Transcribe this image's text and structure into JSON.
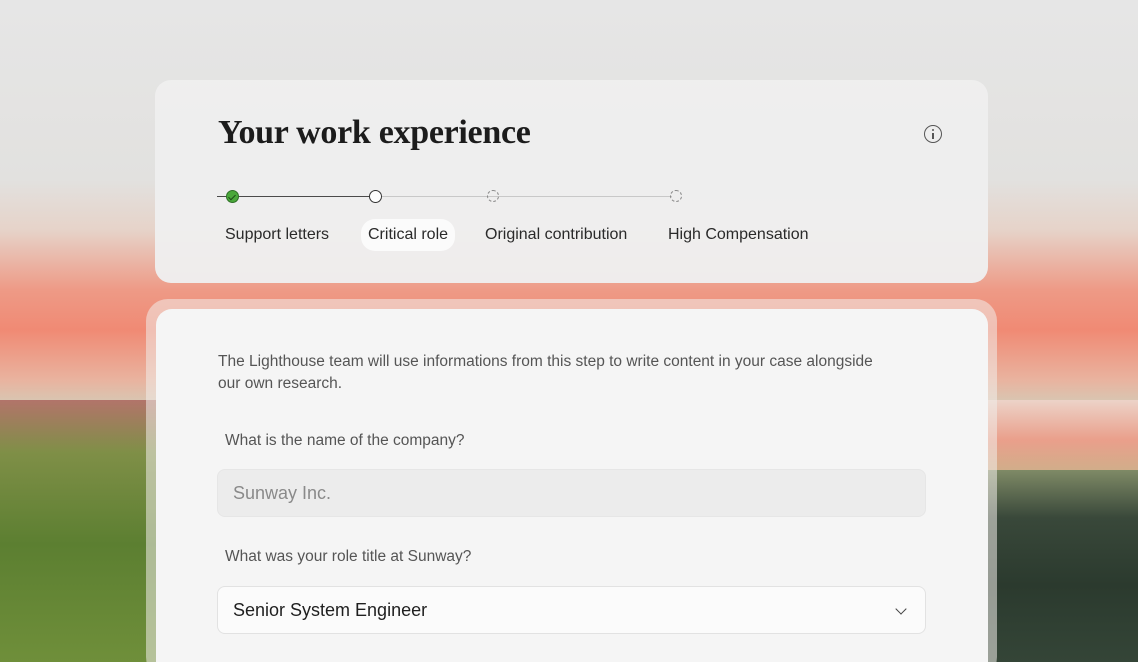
{
  "page": {
    "title": "Your work experience"
  },
  "stepper": {
    "steps": [
      {
        "label": "Support letters",
        "state": "complete"
      },
      {
        "label": "Critical role",
        "state": "current"
      },
      {
        "label": "Original contribution",
        "state": "pending"
      },
      {
        "label": "High Compensation",
        "state": "pending"
      }
    ]
  },
  "form": {
    "intro": "The Lighthouse team will use informations from this step to write content in your case alongside our own research.",
    "company_question": "What is the name of the company?",
    "company_value": "Sunway Inc.",
    "role_question": "What was your role title at Sunway?",
    "role_value": "Senior System Engineer"
  },
  "icons": {
    "info": "info-icon",
    "dropdown": "chevron-down-icon",
    "step_complete": "check-circle-icon"
  },
  "colors": {
    "complete_green": "#4aa83a",
    "text_primary": "#1c1c1c",
    "text_secondary": "#555555"
  }
}
